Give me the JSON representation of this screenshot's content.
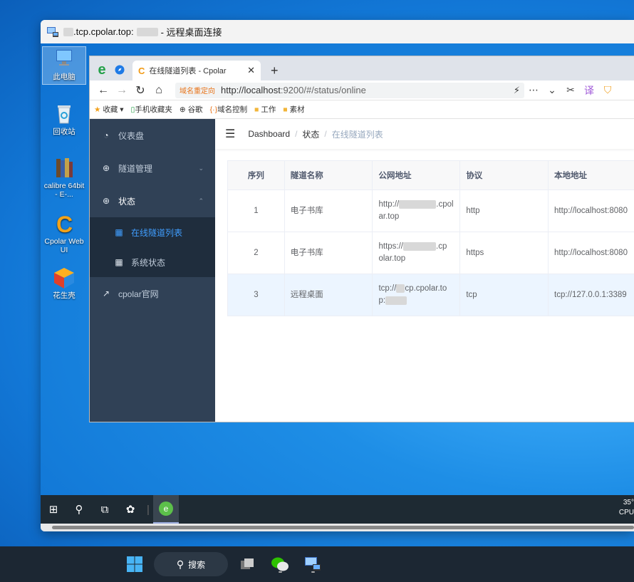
{
  "rdp": {
    "title_prefix": ".tcp.cpolar.top:",
    "title_suffix": " - 远程桌面连接"
  },
  "remote_desktop_icons": [
    {
      "label": "此电脑"
    },
    {
      "label": "回收站"
    },
    {
      "label": "calibre 64bit - E-..."
    },
    {
      "label": "Cpolar Web UI"
    },
    {
      "label": "花生壳"
    }
  ],
  "browser": {
    "tab_title": "在线隧道列表 - Cpolar",
    "tab_icon_letter": "C",
    "new_tab": "+",
    "redirect_label": "域名重定向",
    "url_host": "http://localhost",
    "url_rest": ":9200/#/status/online",
    "bookmarks": [
      "收藏",
      "手机收藏夹",
      "谷歌",
      "域名控制",
      "工作",
      "素材"
    ]
  },
  "sidebar": {
    "items": [
      {
        "label": "仪表盘"
      },
      {
        "label": "隧道管理"
      },
      {
        "label": "状态"
      },
      {
        "label": "在线隧道列表"
      },
      {
        "label": "系统状态"
      },
      {
        "label": "cpolar官网"
      }
    ]
  },
  "breadcrumb": {
    "home": "Dashboard",
    "mid": "状态",
    "current": "在线隧道列表",
    "sep": "/"
  },
  "table": {
    "headers": [
      "序列",
      "隧道名称",
      "公网地址",
      "协议",
      "本地地址"
    ],
    "rows": [
      {
        "idx": "1",
        "name": "电子书库",
        "url_a": "http://",
        "url_b": ".cpol",
        "url_c": "ar.top",
        "proto": "http",
        "local": "http://localhost:8080"
      },
      {
        "idx": "2",
        "name": "电子书库",
        "url_a": "https://",
        "url_b": ".cp",
        "url_c": "olar.top",
        "proto": "https",
        "local": "http://localhost:8080"
      },
      {
        "idx": "3",
        "name": "远程桌面",
        "url_a": "tcp://",
        "url_b": "cp.cpolar.to",
        "url_c": "p:",
        "proto": "tcp",
        "local": "tcp://127.0.0.1:3389"
      }
    ]
  },
  "inner_taskbar": {
    "tray_line1": "35°",
    "tray_line2": "CPU"
  },
  "host_taskbar": {
    "search_label": "搜索"
  }
}
